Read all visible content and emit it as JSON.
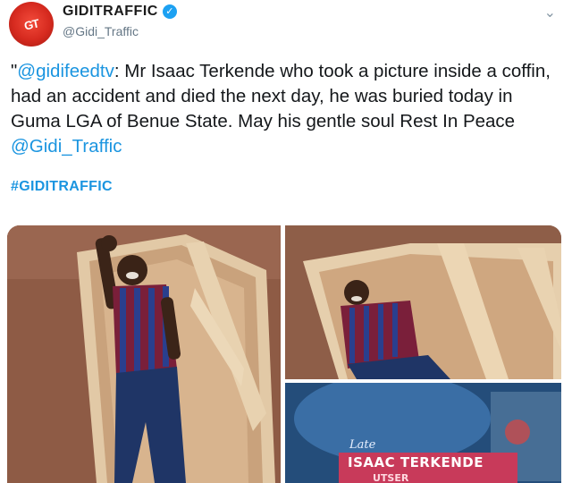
{
  "account": {
    "display_name": "GIDITRAFFIC",
    "handle": "@Gidi_Traffic",
    "avatar_text": "GT",
    "verified": true
  },
  "tweet": {
    "prefix": "\"",
    "mention": "@gidifeedtv",
    "body": ": Mr Isaac Terkende who took a picture inside a coffin, had an accident and died the next day, he was buried today in Guma LGA of Benue State. May his gentle soul Rest In Peace ",
    "trailing_mention": "@Gidi_Traffic",
    "hashtag": "#GIDITRAFFIC"
  },
  "media": {
    "poster_small_text": "Late",
    "poster_name": "ISAAC TERKENDE",
    "poster_partial": "UTSER"
  },
  "colors": {
    "link": "#1b95e0",
    "verified_badge": "#1da1f2",
    "avatar": "#d62a1f"
  },
  "icons": [
    "verified-badge-icon",
    "chevron-down-icon"
  ]
}
